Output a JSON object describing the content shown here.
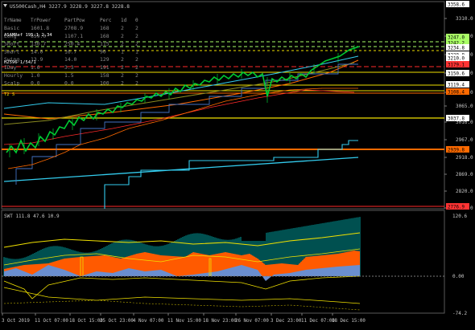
{
  "main_chart": {
    "title": "US500Cash,H4  3227.9 3228.9 3227.8 3228.8",
    "price_axis": [
      "3310.0",
      "3261.0",
      "3212.0",
      "3164.0",
      "3115.0",
      "3065.0",
      "3016.0",
      "2967.0",
      "2918.0",
      "2869.0",
      "2820.0",
      "2771.0"
    ],
    "price_tags": [
      {
        "text": "3358.6",
        "bg": "#ffffff",
        "fg": "#000000"
      },
      {
        "text": "3247.0",
        "bg": "#aaff66",
        "fg": "#000000"
      },
      {
        "text": "3242.2",
        "bg": "#aaff66",
        "fg": "#000000"
      },
      {
        "text": "3234.8",
        "bg": "#ffffff",
        "fg": "#000000"
      },
      {
        "text": "3228.8",
        "bg": "#ffffff",
        "fg": "#000000"
      },
      {
        "text": "3210.0",
        "bg": "#ffffff",
        "fg": "#000000"
      },
      {
        "text": "3179.1",
        "bg": "#ff3333",
        "fg": "#000000"
      },
      {
        "text": "3150.6",
        "bg": "#ffffff",
        "fg": "#000000"
      },
      {
        "text": "3119.4",
        "bg": "#ffffff",
        "fg": "#000000"
      },
      {
        "text": "3108.4",
        "bg": "#ff6a00",
        "fg": "#000000"
      },
      {
        "text": "3037.8",
        "bg": "#ffffff",
        "fg": "#000000"
      },
      {
        "text": "2939.8",
        "bg": "#ff6a00",
        "fg": "#000000"
      },
      {
        "text": "2776.9",
        "bg": "#ff3333",
        "fg": "#000000"
      }
    ],
    "stats_table": {
      "headers": [
        "TrName",
        "TrPower",
        "PartPow",
        "Perc",
        "1d",
        "0"
      ],
      "rows": [
        [
          "Basic",
          "1601.8",
          "2708.9",
          "168",
          "2",
          "2"
        ],
        [
          "Long",
          "659.0",
          "1107.1",
          "168",
          "2",
          "2"
        ],
        [
          "Short",
          "130.7",
          "250.4",
          "115",
          "2",
          "2"
        ],
        [
          "Smart",
          "14.0",
          "16.7",
          "90",
          "1",
          "1"
        ],
        [
          "Swing",
          "13.9",
          "14.0",
          "129",
          "2",
          "2"
        ],
        [
          "IDay",
          "1.6",
          "3.3",
          "191",
          "2",
          "2"
        ],
        [
          "Hourly",
          "1.0",
          "1.5",
          "158",
          "2",
          "2"
        ],
        [
          "Scalp",
          "0.0",
          "0.0",
          "100",
          "2",
          "2"
        ]
      ]
    },
    "overlay_labels": [
      "ASAMRef 195.1 2.34",
      "H2596 1/54/1"
    ],
    "tag_trace": "T2 S"
  },
  "swt": {
    "label": "SWT 111.8 47.6 10.9",
    "axis": [
      "120.6",
      "0.00",
      "-74.2"
    ]
  },
  "time_axis": [
    "3 Oct 2019",
    "11 Oct 07:00",
    "18 Oct 15:00",
    "25 Oct 23:00",
    "4 Nov 07:00",
    "11 Nov 15:00",
    "18 Nov 23:00",
    "26 Nov 07:00",
    "3 Dec 23:00",
    "11 Dec 07:00",
    "18 Dec 15:00"
  ],
  "colors": {
    "candles": "#00cc33",
    "cyan": "#33ccee",
    "steel": "#4472c4",
    "orange": "#ff7a00",
    "yellow": "#f0e000",
    "red": "#ff2a2a",
    "teal": "#00b3b3"
  }
}
